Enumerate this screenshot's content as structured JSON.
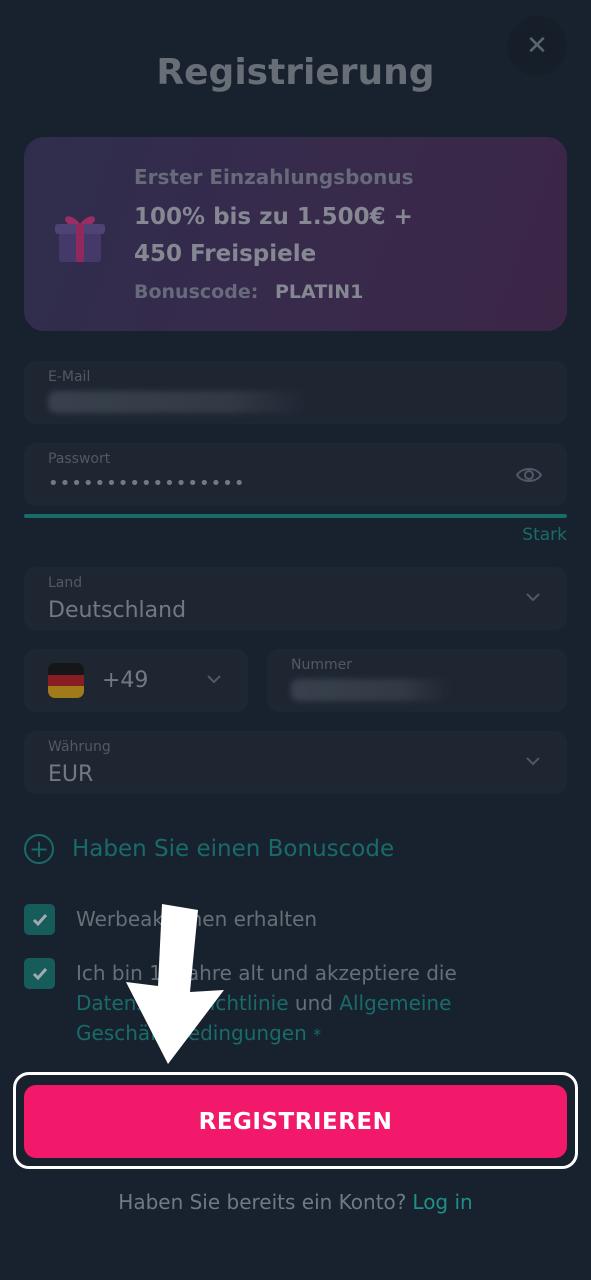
{
  "title": "Registrierung",
  "close_icon": "close-icon",
  "bonus": {
    "subtitle": "Erster Einzahlungsbonus",
    "main": "100% bis zu 1.500€ + 450 Freispiele",
    "code_label": "Bonuscode:",
    "code_value": "PLATIN1",
    "icon": "gift-icon"
  },
  "form": {
    "email_label": "E-Mail",
    "password_label": "Passwort",
    "password_value": "•••••••••••••••••",
    "password_strength": "Stark",
    "country_label": "Land",
    "country_value": "Deutschland",
    "phone_prefix": "+49",
    "phone_label": "Nummer",
    "currency_label": "Währung",
    "currency_value": "EUR"
  },
  "bonus_code_toggle": "Haben Sie einen Bonuscode",
  "checkboxes": {
    "promo": "Werbeaktionen erhalten",
    "terms_text": "Ich bin 18 Jahre alt und akzeptiere die",
    "privacy_link": "Datenschutzrichtlinie",
    "and": "und",
    "terms_link": "Allgemeine Geschäftsbedingungen",
    "required_mark": "*"
  },
  "register_button": "REGISTRIEREN",
  "login": {
    "question": "Haben Sie bereits ein Konto?",
    "link": "Log in"
  },
  "colors": {
    "accent": "#1f8f8a",
    "cta": "#f2186a",
    "background": "#1e2a38"
  }
}
